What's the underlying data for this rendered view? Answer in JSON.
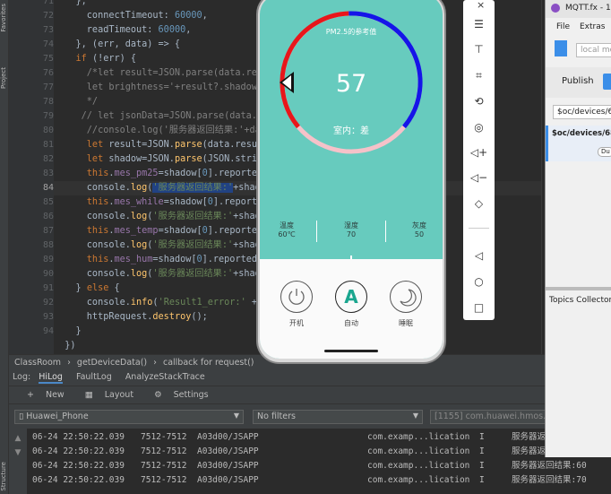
{
  "left_strip": {
    "labels": [
      "Favorites",
      "Project",
      "Structure"
    ]
  },
  "editor": {
    "line_numbers": [
      "71",
      "72",
      "73",
      "74",
      "75",
      "76",
      "77",
      "78",
      "79",
      "80",
      "81",
      "82",
      "83",
      "84",
      "85",
      "86",
      "87",
      "88",
      "89",
      "90",
      "91",
      "92",
      "93",
      "94"
    ],
    "current_line": "84",
    "lines": [
      {
        "seg": [
          [
            "p",
            "    },"
          ]
        ]
      },
      {
        "seg": [
          [
            "p",
            "      connectTimeout: "
          ],
          [
            "num",
            "60000"
          ],
          [
            "p",
            ","
          ]
        ]
      },
      {
        "seg": [
          [
            "p",
            "      readTimeout: "
          ],
          [
            "num",
            "60000"
          ],
          [
            "p",
            ","
          ]
        ]
      },
      {
        "seg": [
          [
            "p",
            "    }, (err, data) => {"
          ]
        ]
      },
      {
        "seg": [
          [
            "kw",
            "    if "
          ],
          [
            "p",
            "(!err) {"
          ]
        ]
      },
      {
        "seg": [
          [
            "cmt",
            "      /*let result=JSON.parse(data.re"
          ]
        ]
      },
      {
        "seg": [
          [
            "cmt",
            "      let brightness='+result?.shadow"
          ]
        ]
      },
      {
        "seg": [
          [
            "cmt",
            "      */"
          ]
        ]
      },
      {
        "seg": [
          [
            "cmt",
            "     // let jsonData=JSON.parse(data.r"
          ]
        ]
      },
      {
        "seg": [
          [
            "cmt",
            "      //console.log('服务器返回结果:'+da"
          ]
        ]
      },
      {
        "seg": [
          [
            "kw",
            "      let "
          ],
          [
            "p",
            "result=JSON."
          ],
          [
            "fn",
            "parse"
          ],
          [
            "p",
            "(data.resul"
          ]
        ]
      },
      {
        "seg": [
          [
            "kw",
            "      let "
          ],
          [
            "p",
            "shadow=JSON."
          ],
          [
            "fn",
            "parse"
          ],
          [
            "p",
            "(JSON.strin"
          ]
        ]
      },
      {
        "seg": [
          [
            "kw",
            "      this"
          ],
          [
            "p",
            "."
          ],
          [
            "fld",
            "mes_pm25"
          ],
          [
            "p",
            "=shadow["
          ],
          [
            "num",
            "0"
          ],
          [
            "p",
            "].reporte"
          ]
        ]
      },
      {
        "seg": [
          [
            "p",
            "      console."
          ],
          [
            "fn",
            "log"
          ],
          [
            "p",
            "("
          ],
          [
            "hlstr",
            "'服务器返回结果:'"
          ],
          [
            "p",
            "+shad"
          ]
        ]
      },
      {
        "seg": [
          [
            "kw",
            "      this"
          ],
          [
            "p",
            "."
          ],
          [
            "fld",
            "mes_while"
          ],
          [
            "p",
            "=shadow["
          ],
          [
            "num",
            "0"
          ],
          [
            "p",
            "].reporte"
          ]
        ]
      },
      {
        "seg": [
          [
            "p",
            "      console."
          ],
          [
            "fn",
            "log"
          ],
          [
            "p",
            "("
          ],
          [
            "str",
            "'服务器返回结果:'"
          ],
          [
            "p",
            "+shad"
          ]
        ]
      },
      {
        "seg": [
          [
            "kw",
            "      this"
          ],
          [
            "p",
            "."
          ],
          [
            "fld",
            "mes_temp"
          ],
          [
            "p",
            "=shadow["
          ],
          [
            "num",
            "0"
          ],
          [
            "p",
            "].reporte"
          ]
        ]
      },
      {
        "seg": [
          [
            "p",
            "      console."
          ],
          [
            "fn",
            "log"
          ],
          [
            "p",
            "("
          ],
          [
            "str",
            "'服务器返回结果:'"
          ],
          [
            "p",
            "+shad"
          ]
        ]
      },
      {
        "seg": [
          [
            "kw",
            "      this"
          ],
          [
            "p",
            "."
          ],
          [
            "fld",
            "mes_hum"
          ],
          [
            "p",
            "=shadow["
          ],
          [
            "num",
            "0"
          ],
          [
            "p",
            "].reported"
          ]
        ]
      },
      {
        "seg": [
          [
            "p",
            "      console."
          ],
          [
            "fn",
            "log"
          ],
          [
            "p",
            "("
          ],
          [
            "str",
            "'服务器返回结果:'"
          ],
          [
            "p",
            "+shad"
          ]
        ]
      },
      {
        "seg": [
          [
            "p",
            "    } "
          ],
          [
            "kw",
            "else "
          ],
          [
            "p",
            "{"
          ]
        ]
      },
      {
        "seg": [
          [
            "p",
            "      console."
          ],
          [
            "fn",
            "info"
          ],
          [
            "p",
            "("
          ],
          [
            "str",
            "'Result1_error:'"
          ],
          [
            "p",
            " +"
          ]
        ]
      },
      {
        "seg": [
          [
            "p",
            "      httpRequest."
          ],
          [
            "fn",
            "destroy"
          ],
          [
            "p",
            "();"
          ]
        ]
      },
      {
        "seg": [
          [
            "p",
            "    }"
          ]
        ]
      },
      {
        "seg": [
          [
            "p",
            "  })"
          ]
        ]
      }
    ]
  },
  "breadcrumb": [
    "ClassRoom",
    "›",
    "getDeviceData()",
    "›",
    "callback for request()"
  ],
  "log_tabs": {
    "prefix": "Log:",
    "items": [
      "HiLog",
      "FaultLog",
      "AnalyzeStackTrace"
    ]
  },
  "log_tools": {
    "new": "New",
    "layout": "Layout",
    "settings": "Settings"
  },
  "log_filters": {
    "device": "Huawei_Phone",
    "level": "No filters",
    "process": "[1155] com.huawei.hmos.loca"
  },
  "log_rows": [
    {
      "time": "06-24 22:50:22.039",
      "pid": "7512-7512",
      "tag": "A03d00/JSAPP",
      "pkg": "com.examp...lication",
      "lvl": "I",
      "msg": "服务器返"
    },
    {
      "time": "06-24 22:50:22.039",
      "pid": "7512-7512",
      "tag": "A03d00/JSAPP",
      "pkg": "com.examp...lication",
      "lvl": "I",
      "msg": "服务器返"
    },
    {
      "time": "06-24 22:50:22.039",
      "pid": "7512-7512",
      "tag": "A03d00/JSAPP",
      "pkg": "com.examp...lication",
      "lvl": "I",
      "msg": "服务器返回结果:60"
    },
    {
      "time": "06-24 22:50:22.039",
      "pid": "7512-7512",
      "tag": "A03d00/JSAPP",
      "pkg": "com.examp...lication",
      "lvl": "I",
      "msg": "服务器返回结果:70"
    }
  ],
  "app": {
    "gauge_title": "PM2.5的参考值",
    "gauge_value": "57",
    "gauge_status": "室内：差",
    "stats": [
      {
        "label": "温度",
        "value": "60℃"
      },
      {
        "label": "湿度",
        "value": "70"
      },
      {
        "label": "灰度",
        "value": "50"
      }
    ],
    "controls": [
      {
        "label": "开机",
        "icon": "power-icon"
      },
      {
        "label": "自动",
        "icon": "auto-a-icon",
        "glyph": "A"
      },
      {
        "label": "睡眠",
        "icon": "moon-icon"
      }
    ],
    "colors": {
      "bg": "#67cbbe",
      "red": "#e8161b",
      "blue": "#1515e8",
      "pink": "#f5c2c9"
    }
  },
  "emulator_toolbar": [
    "close-icon",
    "menu-icon",
    "pin-icon",
    "crop-icon",
    "rotate-icon",
    "screenshot-icon",
    "volume-up-icon",
    "volume-down-icon",
    "shake-icon",
    "back-icon",
    "home-icon",
    "recent-icon"
  ],
  "mqtt": {
    "title": "MQTT.fx - 1.7.",
    "menu": [
      "File",
      "Extras"
    ],
    "profile": "local mo",
    "publish_tab": "Publish",
    "topic": "$oc/devices/68",
    "sub_topic": "$oc/devices/6852",
    "qos": "Du",
    "collector": "Topics Collector ("
  }
}
